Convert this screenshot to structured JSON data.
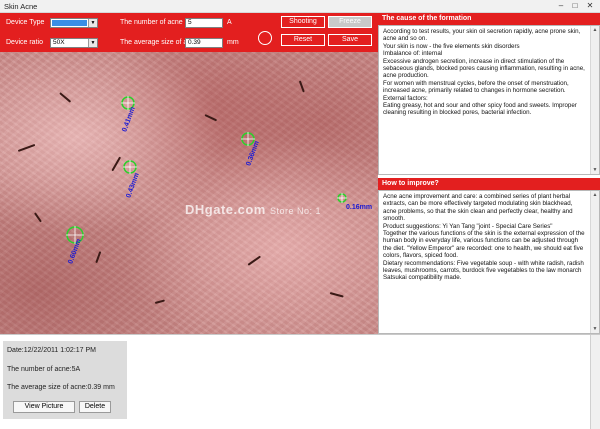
{
  "window": {
    "title": "Skin Acne",
    "minimize": "–",
    "maximize": "□",
    "close": "✕"
  },
  "controls": {
    "device_type_label": "Device Type",
    "device_type_value": "",
    "device_ratio_label": "Device ratio",
    "device_ratio_value": "50X",
    "acne_number_label": "The number of acne",
    "acne_number_value": "5",
    "acne_number_unit": "A",
    "acne_size_label": "The average size of acne",
    "acne_size_value": "0.39",
    "acne_size_unit": "mm",
    "shooting": "Shooting",
    "freeze": "Freeze",
    "reset": "Reset",
    "save": "Save",
    "dropdown_arrow": "▼"
  },
  "image": {
    "markers": [
      {
        "label": "0.41mm"
      },
      {
        "label": "0.43mm"
      },
      {
        "label": "0.36mm"
      },
      {
        "label": "0.16mm"
      },
      {
        "label": "0.60mm"
      }
    ],
    "watermark_main": "DHgate.com",
    "watermark_sub": "Store No: 1"
  },
  "cause_panel": {
    "title": "The cause of the formation",
    "lines": [
      "According to test results, your skin oil secretion rapidly, acne prone skin, acne and so on.",
      " Your skin is now - the five elements skin disorders",
      "Imbalance of: internal",
      " Excessive androgen secretion, increase in direct stimulation of the sebaceous glands, blocked pores causing inflammation, resulting in acne, acne production.",
      " For women with menstrual cycles, before the onset of menstruation, increased acne, primarily related to changes in hormone secretion.",
      "External factors:",
      " Eating greasy, hot and sour and other spicy food and sweets. Improper cleaning resulting in blocked pores, bacterial infection."
    ]
  },
  "improve_panel": {
    "title": "How to improve?",
    "lines": [
      "Acne acne improvement and care: a combined series of plant herbal extracts, can be more effectively targeted modulating skin blackhead, acne problems, so that the skin clean and perfectly clear, healthy and smooth.",
      "Product suggestions: Yi Yan Tang \"joint - Special Care Series\"",
      "Together the various functions of the skin is the external expression of the human body in everyday life, various functions can be adjusted through the diet. \"Yellow Emperor\" are recorded: one to health, we should eat five colors, flavors, spiced food.",
      "Dietary recommendations: Five vegetable soup - with white radish, radish leaves, mushrooms, carrots, burdock five vegetables to the law monarch Satsukai compatibility made."
    ]
  },
  "record": {
    "date": "Date:12/22/2011 1:02:17 PM",
    "count": "The number of acne:5A",
    "size": "The average size of acne:0.39 mm",
    "view_picture": "View Picture",
    "delete": "Delete"
  },
  "scroll": {
    "up": "▲",
    "down": "▼"
  }
}
